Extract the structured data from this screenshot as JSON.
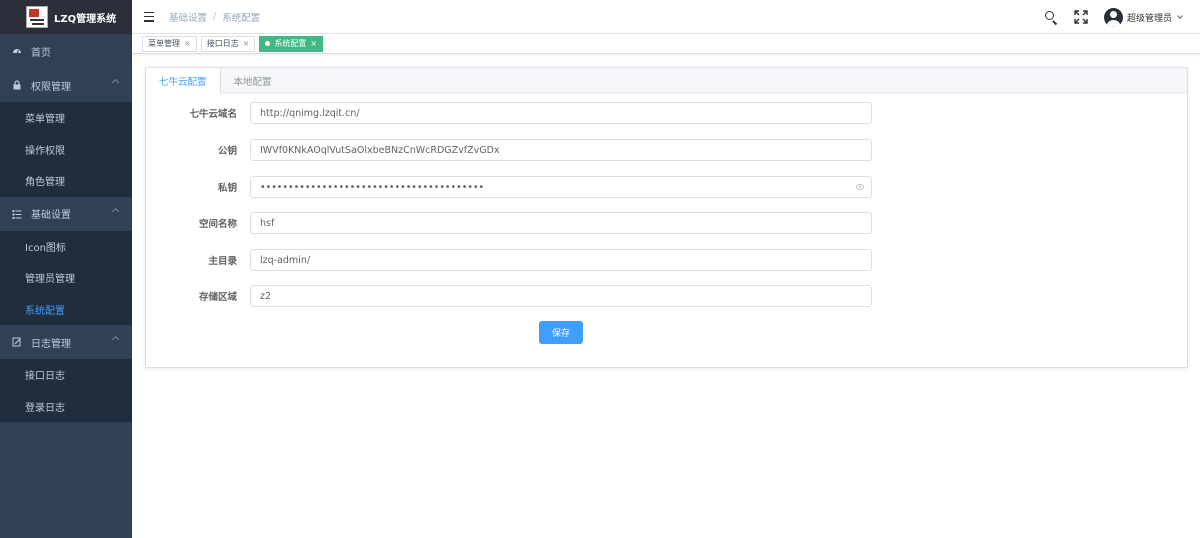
{
  "app": {
    "title": "LZQ管理系统"
  },
  "sidebar": {
    "home": "首页",
    "groups": [
      {
        "label": "权限管理",
        "items": [
          "菜单管理",
          "操作权限",
          "角色管理"
        ]
      },
      {
        "label": "基础设置",
        "items": [
          "Icon图标",
          "管理员管理",
          "系统配置"
        ]
      },
      {
        "label": "日志管理",
        "items": [
          "接口日志",
          "登录日志"
        ]
      }
    ],
    "active_item": "系统配置"
  },
  "header": {
    "breadcrumb": [
      "基础设置",
      "系统配置"
    ],
    "breadcrumb_sep": "/",
    "username": "超级管理员"
  },
  "tags": [
    {
      "label": "菜单管理",
      "close": "×"
    },
    {
      "label": "接口日志",
      "close": "×"
    },
    {
      "label": "系统配置",
      "close": "×",
      "active": true
    }
  ],
  "tabs": [
    "七牛云配置",
    "本地配置"
  ],
  "form": {
    "fields": [
      {
        "label": "七牛云域名",
        "value": "http://qnimg.lzqit.cn/"
      },
      {
        "label": "公钥",
        "value": "IWVf0KNkAOqlVutSaOlxbeBNzCnWcRDGZvfZvGDx"
      },
      {
        "label": "私钥",
        "value": "••••••••••••••••••••••••••••••••••••••••"
      },
      {
        "label": "空间名称",
        "value": "hsf"
      },
      {
        "label": "主目录",
        "value": "lzq-admin/"
      },
      {
        "label": "存储区域",
        "value": "z2"
      }
    ],
    "save_label": "保存"
  },
  "colors": {
    "sidebar_bg": "#304156",
    "submenu_bg": "#1f2d3d",
    "primary": "#409eff",
    "tag_active": "#42b983"
  }
}
